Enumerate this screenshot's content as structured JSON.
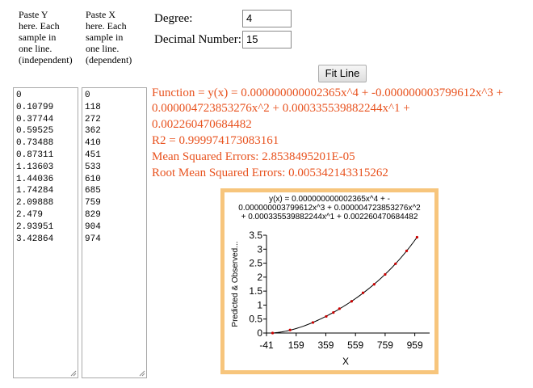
{
  "y_input": {
    "label_lines": [
      "Paste Y",
      "here. Each",
      "sample in",
      "one line.",
      "(independent)"
    ],
    "values": [
      "0",
      "0.10799",
      "0.37744",
      "0.59525",
      "0.73488",
      "0.87311",
      "1.13603",
      "1.44036",
      "1.74284",
      "2.09888",
      "2.479",
      "2.93951",
      "3.42864"
    ]
  },
  "x_input": {
    "label_lines": [
      "Paste X",
      "here. Each",
      "sample in",
      "one line.",
      "(dependent)"
    ],
    "values": [
      "0",
      "118",
      "272",
      "362",
      "410",
      "451",
      "533",
      "610",
      "685",
      "759",
      "829",
      "904",
      "974"
    ]
  },
  "form": {
    "degree_label": "Degree:",
    "degree_value": "4",
    "decimal_label": "Decimal Number:",
    "decimal_value": "15",
    "fit_button": "Fit Line"
  },
  "results": {
    "function_lines": [
      "Function = y(x) = 0.000000000002365x^4 + -0.000000003799612x^3 +",
      "0.000004723853276x^2 + 0.000335539882244x^1 +",
      "0.002260470684482"
    ],
    "r2": "R2 = 0.999974173083161",
    "mse": "Mean Squared Errors: 2.8538495201E-05",
    "rmse": "Root Mean Squared Errors: 0.005342143315262"
  },
  "colors": {
    "result_text": "#e8521e",
    "chart_border": "#f7c57c",
    "point": "#cc0000"
  },
  "chart_data": {
    "type": "scatter",
    "title_lines": [
      "y(x) = 0.000000000002365x^4 + -",
      "0.000000003799612x^3 + 0.000004723853276x^2",
      "+ 0.000335539882244x^1 + 0.002260470684482"
    ],
    "xlabel": "X",
    "ylabel": "Predicted & Observed...",
    "xlim": [
      -41,
      1059
    ],
    "ylim": [
      0,
      3.5
    ],
    "x_ticks": [
      "-41",
      "159",
      "359",
      "559",
      "759",
      "959"
    ],
    "x_tick_values": [
      -41,
      159,
      359,
      559,
      759,
      959
    ],
    "y_ticks": [
      "0",
      "0.5",
      "1",
      "1.5",
      "2",
      "2.5",
      "3",
      "3.5"
    ],
    "y_tick_values": [
      0,
      0.5,
      1,
      1.5,
      2,
      2.5,
      3,
      3.5
    ],
    "grid": false,
    "series": [
      {
        "values": [
          {
            "x": 0,
            "y": 0
          },
          {
            "x": 118,
            "y": 0.10799
          },
          {
            "x": 272,
            "y": 0.37744
          },
          {
            "x": 362,
            "y": 0.59525
          },
          {
            "x": 410,
            "y": 0.73488
          },
          {
            "x": 451,
            "y": 0.87311
          },
          {
            "x": 533,
            "y": 1.13603
          },
          {
            "x": 610,
            "y": 1.44036
          },
          {
            "x": 685,
            "y": 1.74284
          },
          {
            "x": 759,
            "y": 2.09888
          },
          {
            "x": 829,
            "y": 2.479
          },
          {
            "x": 904,
            "y": 2.93951
          },
          {
            "x": 974,
            "y": 3.42864
          }
        ]
      }
    ],
    "fit_coefficients": [
      0.002260470684482,
      0.000335539882244,
      4.723853276e-06,
      -3.799612e-09,
      2.365e-12
    ]
  }
}
